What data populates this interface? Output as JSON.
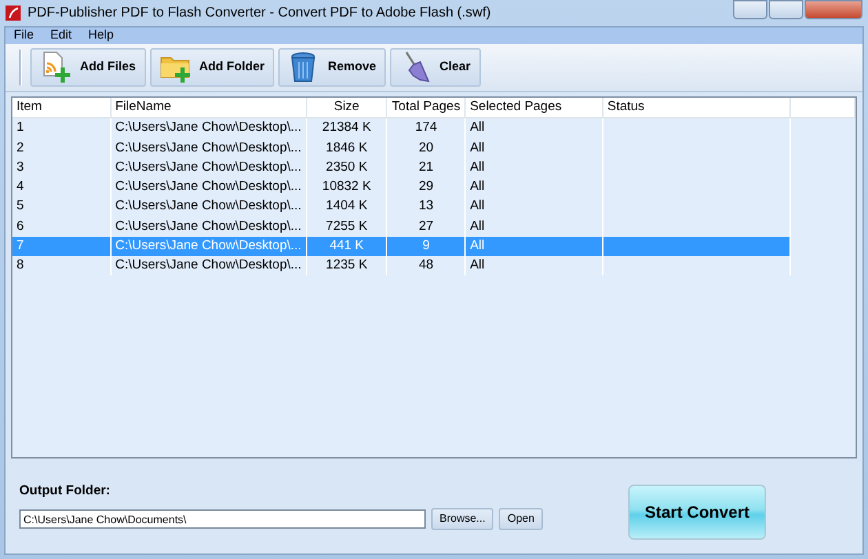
{
  "window": {
    "title": "PDF-Publisher PDF to Flash Converter - Convert PDF to Adobe Flash (.swf)"
  },
  "menu": [
    {
      "label": "File"
    },
    {
      "label": "Edit"
    },
    {
      "label": "Help"
    }
  ],
  "toolbar": [
    {
      "label": "Add Files",
      "kind": "add-files"
    },
    {
      "label": "Add Folder",
      "kind": "add-folder"
    },
    {
      "label": "Remove",
      "kind": "remove"
    },
    {
      "label": "Clear",
      "kind": "clear"
    }
  ],
  "table": {
    "columns": [
      "Item",
      "FileName",
      "Size",
      "Total Pages",
      "Selected Pages",
      "Status"
    ],
    "rows": [
      {
        "cells": [
          "1",
          "C:\\Users\\Jane Chow\\Desktop\\...",
          "21384 K",
          "174",
          "All"
        ],
        "selected": false
      },
      {
        "cells": [
          "2",
          "C:\\Users\\Jane Chow\\Desktop\\...",
          "1846 K",
          "20",
          "All"
        ],
        "selected": false
      },
      {
        "cells": [
          "3",
          "C:\\Users\\Jane Chow\\Desktop\\...",
          "2350 K",
          "21",
          "All"
        ],
        "selected": false
      },
      {
        "cells": [
          "4",
          "C:\\Users\\Jane Chow\\Desktop\\...",
          "10832 K",
          "29",
          "All"
        ],
        "selected": false
      },
      {
        "cells": [
          "5",
          "C:\\Users\\Jane Chow\\Desktop\\...",
          "1404 K",
          "13",
          "All"
        ],
        "selected": false
      },
      {
        "cells": [
          "6",
          "C:\\Users\\Jane Chow\\Desktop\\...",
          "7255 K",
          "27",
          "All"
        ],
        "selected": false
      },
      {
        "cells": [
          "7",
          "C:\\Users\\Jane Chow\\Desktop\\...",
          "441 K",
          "9",
          "All"
        ],
        "selected": true
      },
      {
        "cells": [
          "8",
          "C:\\Users\\Jane Chow\\Desktop\\...",
          "1235 K",
          "48",
          "All"
        ],
        "selected": false
      }
    ]
  },
  "output": {
    "label": "Output Folder:",
    "value": "C:\\Users\\Jane Chow\\Documents\\",
    "browse": {
      "label": "Browse..."
    },
    "open": {
      "label": "Open"
    }
  },
  "convert": {
    "label": "Start Convert"
  }
}
